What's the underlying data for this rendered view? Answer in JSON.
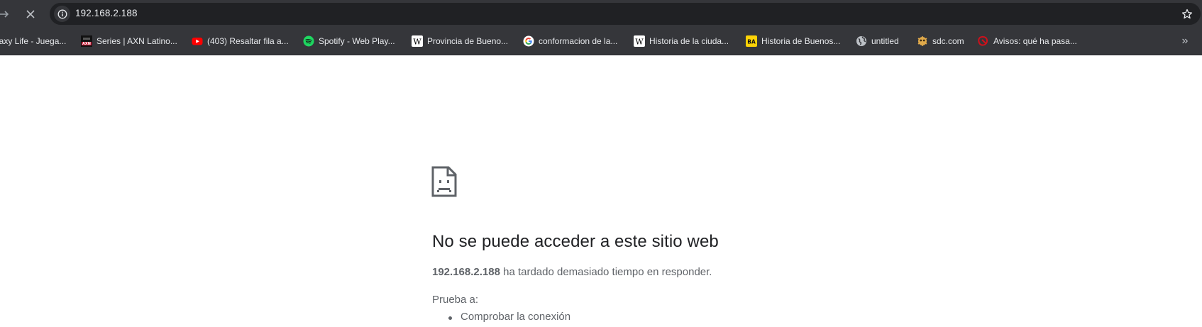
{
  "omnibox": {
    "url": "192.168.2.188"
  },
  "bookmarks": [
    {
      "label": "laxy Life - Juega...",
      "icon": "none"
    },
    {
      "label": "Series | AXN Latino...",
      "icon": "axn-icon"
    },
    {
      "label": "(403) Resaltar fila a...",
      "icon": "youtube-icon"
    },
    {
      "label": "Spotify - Web Play...",
      "icon": "spotify-icon"
    },
    {
      "label": "Provincia de Bueno...",
      "icon": "wikipedia-icon"
    },
    {
      "label": "conformacion de la...",
      "icon": "google-icon"
    },
    {
      "label": "Historia de la ciuda...",
      "icon": "wikipedia-icon"
    },
    {
      "label": "Historia de Buenos...",
      "icon": "ba-icon"
    },
    {
      "label": "untitled",
      "icon": "globe-icon"
    },
    {
      "label": "sdc.com",
      "icon": "sdc-icon"
    },
    {
      "label": "Avisos: qué ha pasa...",
      "icon": "avisos-icon"
    }
  ],
  "error": {
    "title": "No se puede acceder a este sitio web",
    "host": "192.168.2.188",
    "message": " ha tardado demasiado tiempo en responder.",
    "try_label": "Prueba a:",
    "suggestions": [
      "Comprobar la conexión"
    ]
  },
  "colors": {
    "toolbar_bg": "#35363a",
    "omnibox_bg": "#202124",
    "page_bg": "#ffffff",
    "title_text": "#202124",
    "body_text": "#5f6368"
  }
}
